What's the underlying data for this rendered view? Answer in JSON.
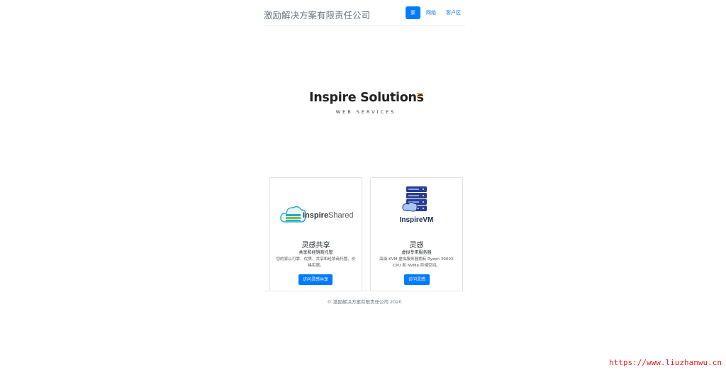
{
  "header": {
    "brand": "激励解决方案有限责任公司",
    "nav": [
      {
        "label": "家",
        "active": true
      },
      {
        "label": "网络",
        "active": false
      },
      {
        "label": "客户区",
        "active": false
      }
    ]
  },
  "logo": {
    "word": "Inspire Solutions",
    "subtitle": "WEB SERVICES"
  },
  "cards": [
    {
      "image_text": "InspireShared",
      "title": "灵感共享",
      "subtitle": "共享和经销商托管",
      "text": "您的家以可靠、优质、共享和经销商托管、价格实惠。",
      "button": "访问灵感共享"
    },
    {
      "image_text": "InspireVM",
      "title": "灵感",
      "subtitle": "虚拟专用服务器",
      "text": "高级 KVM 虚拟服务器拥有 Ryzen 3900X CPU 和 NVMe 存储空间。",
      "button": "访问灵感"
    }
  ],
  "footer": "© 激励解决方案有限责任公司 2020",
  "watermark": "https://www.liuzhanwu.cn",
  "colors": {
    "primary": "#007bff",
    "accent": "#f5a623",
    "muted": "#6c757d"
  }
}
